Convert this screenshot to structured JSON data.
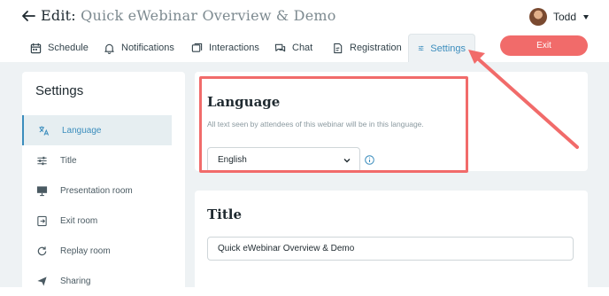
{
  "header": {
    "edit_label": "Edit:",
    "webinar_name": "Quick eWebinar Overview & Demo",
    "user_name": "Todd"
  },
  "tabs": [
    {
      "label": "Schedule",
      "icon": "calendar-icon"
    },
    {
      "label": "Notifications",
      "icon": "bell-icon"
    },
    {
      "label": "Interactions",
      "icon": "interactions-icon"
    },
    {
      "label": "Chat",
      "icon": "chat-icon"
    },
    {
      "label": "Registration",
      "icon": "registration-icon"
    },
    {
      "label": "Settings",
      "icon": "sliders-icon",
      "active": true
    }
  ],
  "exit_label": "Exit",
  "sidebar": {
    "title": "Settings",
    "items": [
      {
        "label": "Language",
        "icon": "translate-icon",
        "active": true
      },
      {
        "label": "Title",
        "icon": "sliders-icon"
      },
      {
        "label": "Presentation room",
        "icon": "presentation-icon"
      },
      {
        "label": "Exit room",
        "icon": "exit-room-icon"
      },
      {
        "label": "Replay room",
        "icon": "replay-icon"
      },
      {
        "label": "Sharing",
        "icon": "send-icon"
      }
    ]
  },
  "language": {
    "heading": "Language",
    "description": "All text seen by attendees of this webinar will be in this language.",
    "selected": "English"
  },
  "title_section": {
    "heading": "Title",
    "value": "Quick eWebinar Overview & Demo"
  },
  "colors": {
    "accent": "#3b8dbd",
    "exit": "#f16b6a",
    "highlight": "#f16b6a",
    "background": "#eef2f4"
  }
}
